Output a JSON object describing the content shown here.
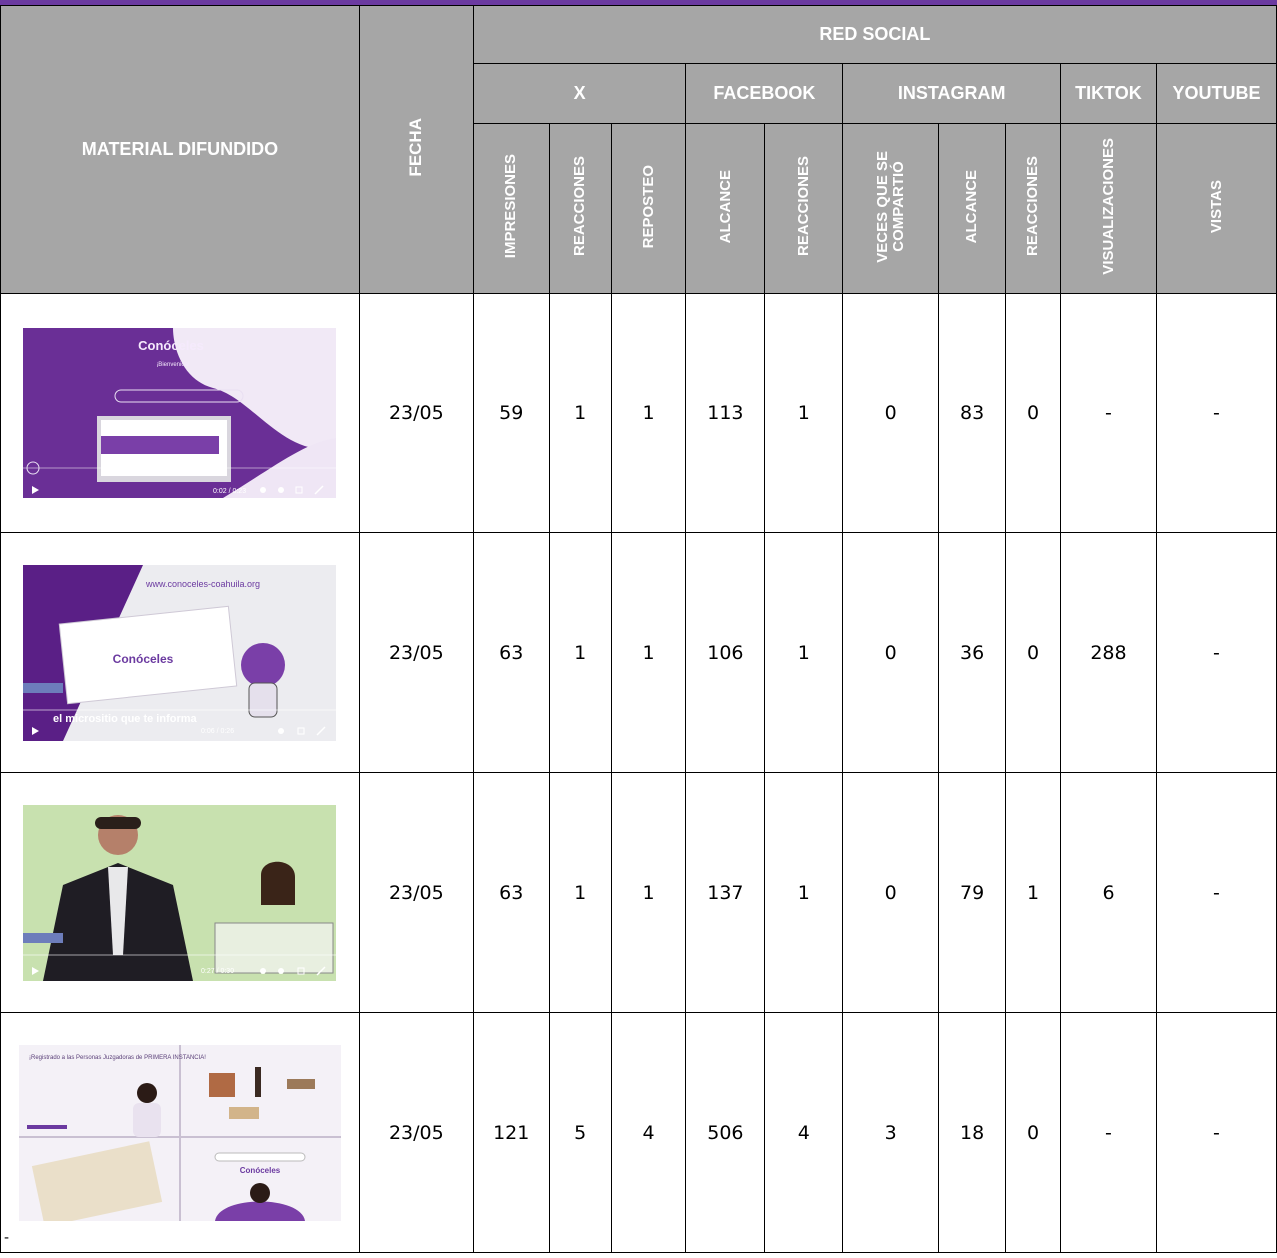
{
  "header": {
    "material": "MATERIAL DIFUNDIDO",
    "fecha": "FECHA",
    "red_social": "RED SOCIAL",
    "networks": {
      "x": "X",
      "facebook": "FACEBOOK",
      "instagram": "INSTAGRAM",
      "tiktok": "TIKTOK",
      "youtube": "YOUTUBE"
    },
    "metrics": {
      "x_impresiones": "IMPRESIONES",
      "x_reacciones": "REACCIONES",
      "x_reposteo": "REPOSTEO",
      "fb_alcance": "ALCANCE",
      "fb_reacciones": "REACCIONES",
      "ig_veces": "VECES QUE SE\nCOMPARTIÓ",
      "ig_alcance": "ALCANCE",
      "ig_reacciones": "REACCIONES",
      "tt_visualizaciones": "VISUALIZACIONES",
      "yt_vistas": "VISTAS"
    }
  },
  "rows": [
    {
      "fecha": "23/05",
      "x_impresiones": "59",
      "x_reacciones": "1",
      "x_reposteo": "1",
      "fb_alcance": "113",
      "fb_reacciones": "1",
      "ig_veces": "0",
      "ig_alcance": "83",
      "ig_reacciones": "0",
      "tt_visualizaciones": "-",
      "yt_vistas": "-",
      "thumb": {
        "title": "Conóceles",
        "subtitle": "¡Bienvenida!",
        "time": "0:02 / 0:23"
      }
    },
    {
      "fecha": "23/05",
      "x_impresiones": "63",
      "x_reacciones": "1",
      "x_reposteo": "1",
      "fb_alcance": "106",
      "fb_reacciones": "1",
      "ig_veces": "0",
      "ig_alcance": "36",
      "ig_reacciones": "0",
      "tt_visualizaciones": "288",
      "yt_vistas": "-",
      "thumb": {
        "title": "Conóceles",
        "url": "www.conoceles-coahuila.org",
        "caption": "el micrositio que te informa",
        "time": "0:06 / 0:26"
      }
    },
    {
      "fecha": "23/05",
      "x_impresiones": "63",
      "x_reacciones": "1",
      "x_reposteo": "1",
      "fb_alcance": "137",
      "fb_reacciones": "1",
      "ig_veces": "0",
      "ig_alcance": "79",
      "ig_reacciones": "1",
      "tt_visualizaciones": "6",
      "yt_vistas": "-",
      "thumb": {
        "time": "0:27 / 0:30"
      }
    },
    {
      "fecha": "23/05",
      "x_impresiones": "121",
      "x_reacciones": "5",
      "x_reposteo": "4",
      "fb_alcance": "506",
      "fb_reacciones": "4",
      "ig_veces": "3",
      "ig_alcance": "18",
      "ig_reacciones": "0",
      "tt_visualizaciones": "-",
      "yt_vistas": "-",
      "dash": "-",
      "thumb": {
        "title": "Conóceles",
        "heading": "¡Registrado a las Personas Juzgadoras de PRIMERA INSTANCIA!"
      }
    }
  ],
  "colors": {
    "header_bg": "#a6a6a6",
    "header_text": "#ffffff",
    "topbar": "#6b3aa0",
    "purple": "#7a3fa8"
  }
}
